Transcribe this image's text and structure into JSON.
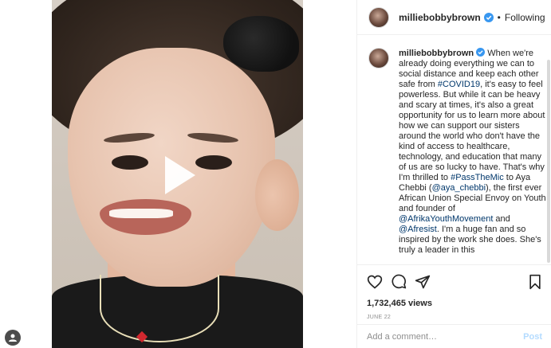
{
  "post": {
    "username": "milliebobbybrown",
    "follow_label": "Following",
    "separator": "•",
    "caption": {
      "p1": "When we're already doing everything we can to social distance and keep each other safe from ",
      "tag1": "#COVID19",
      "p2": ", it's easy to feel powerless. But while it can be heavy and scary at times, it's also a great opportunity for us to learn more about how we can support our sisters around the world who don't have the kind of access to healthcare, technology, and education that many of us are so lucky to have. That's why I'm thrilled to ",
      "tag2": "#PassTheMic",
      "p3": " to Aya Chebbi (",
      "mention1": "@aya_chebbi",
      "p4": "), the first ever African Union Special Envoy on Youth and founder of ",
      "mention2": "@AfrikaYouthMovement",
      "p5": " and ",
      "mention3": "@Afresist",
      "p6": ". I'm a huge fan and so inspired by the work she does. She's truly a leader in this"
    },
    "views": "1,732,465 views",
    "date": "JUNE 22",
    "comment_placeholder": "Add a comment…",
    "post_label": "Post"
  },
  "icons": {
    "verified": "verified-badge-icon",
    "play": "play-icon",
    "like": "heart-icon",
    "comment": "comment-icon",
    "share": "share-icon",
    "save": "bookmark-icon",
    "user": "user-icon"
  },
  "colors": {
    "verified": "#3897f0",
    "link": "#00376b",
    "post_disabled": "#b3dbff"
  }
}
